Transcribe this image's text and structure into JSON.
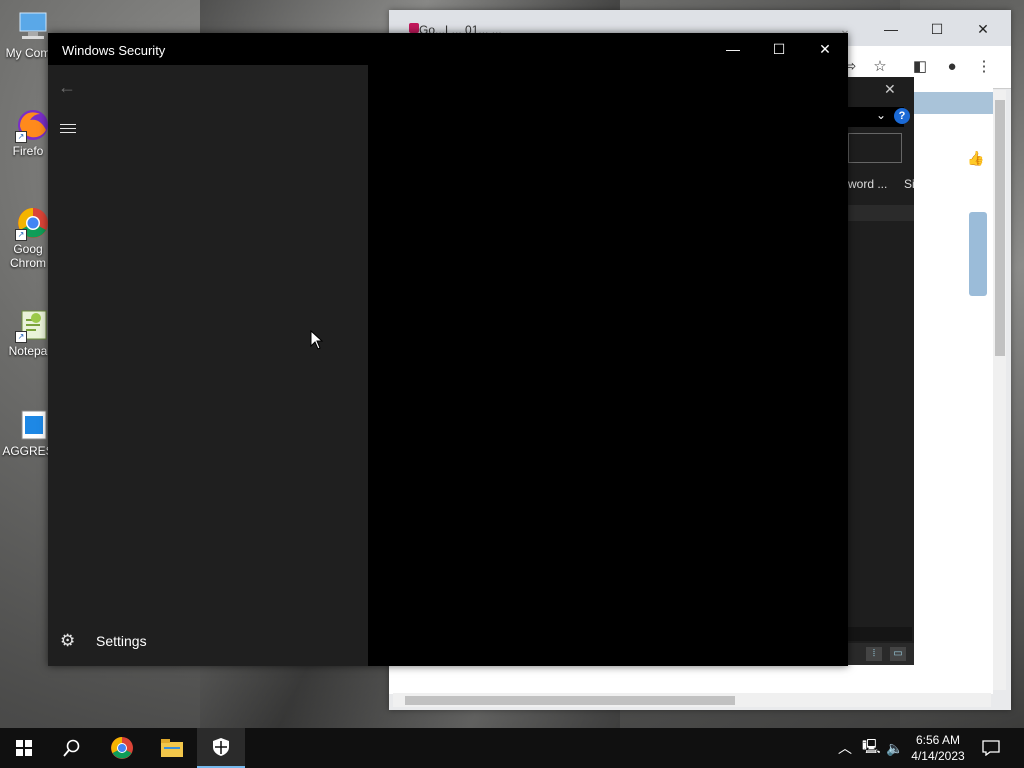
{
  "desktop": {
    "icons": [
      {
        "label": "My Com",
        "icon": "computer-icon"
      },
      {
        "label": "Firefo",
        "icon": "firefox-icon"
      },
      {
        "label": "Goog",
        "label2": "Chrom",
        "icon": "chrome-icon"
      },
      {
        "label": "Notepa",
        "icon": "notepad-icon"
      },
      {
        "label": "AGGRES",
        "icon": "document-icon"
      }
    ]
  },
  "browser": {
    "tab_text": "Go...L... 01... ...",
    "panel_text": "word ...",
    "panel_text2": "Si"
  },
  "winsec": {
    "title": "Windows Security",
    "back_label": "←",
    "settings_label": "Settings",
    "minimize": "—",
    "maximize": "☐",
    "close": "✕"
  },
  "taskbar": {
    "time": "6:56 AM",
    "date": "4/14/2023",
    "apps": [
      "start-icon",
      "search-icon",
      "chrome-icon",
      "file-explorer-icon",
      "windows-security-icon"
    ]
  },
  "colors": {
    "accent": "#76b9ed",
    "winsec_nav": "#1f1f1f",
    "taskbar": "#101010"
  }
}
